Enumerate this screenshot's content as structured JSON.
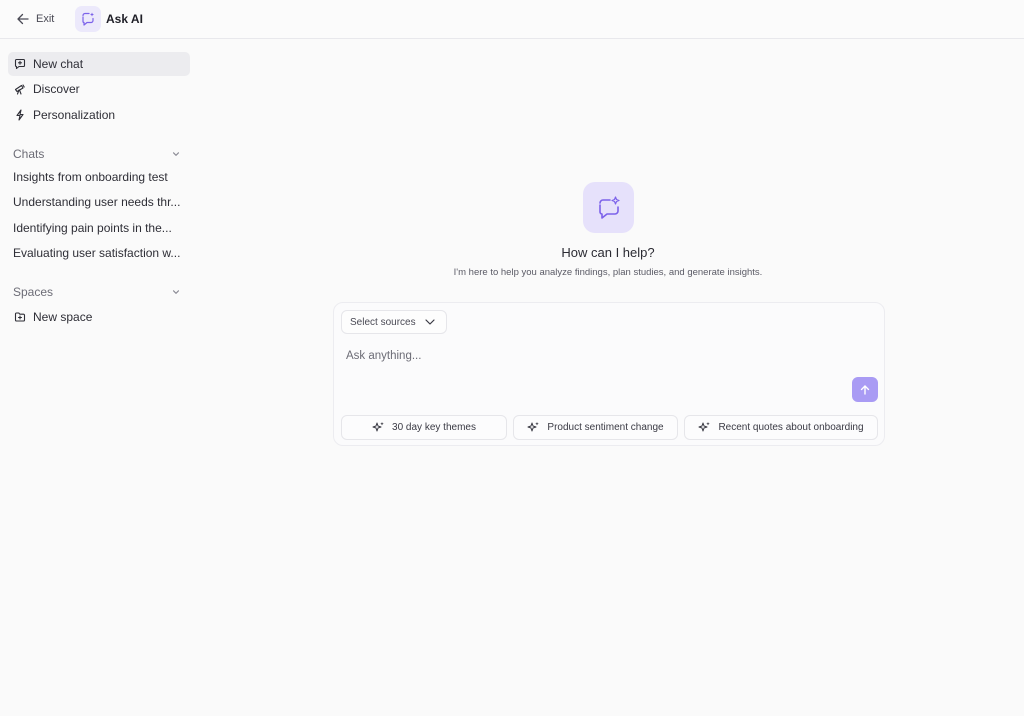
{
  "header": {
    "exit_label": "Exit",
    "app_title": "Ask AI",
    "app_icon": "chat-sparkle-icon"
  },
  "sidebar": {
    "nav": [
      {
        "label": "New chat",
        "icon": "chat-plus-icon",
        "active": true
      },
      {
        "label": "Discover",
        "icon": "telescope-icon",
        "active": false
      },
      {
        "label": "Personalization",
        "icon": "bolt-icon",
        "active": false
      }
    ],
    "chats_label": "Chats",
    "chats": [
      "Insights from onboarding test",
      "Understanding user needs thr...",
      "Identifying pain points in the...",
      "Evaluating user satisfaction w..."
    ],
    "spaces_label": "Spaces",
    "new_space_label": "New space"
  },
  "main": {
    "title": "How can I help?",
    "subtitle": "I'm here to help you analyze findings, plan studies, and generate insights.",
    "select_sources_label": "Select sources",
    "input_placeholder": "Ask anything...",
    "suggestions": [
      "30 day key themes",
      "Product sentiment change",
      "Recent quotes about onboarding"
    ]
  },
  "colors": {
    "accent": "#a99bf4",
    "accent_light": "#e6e1fb",
    "icon_stroke": "#7c62ea"
  }
}
